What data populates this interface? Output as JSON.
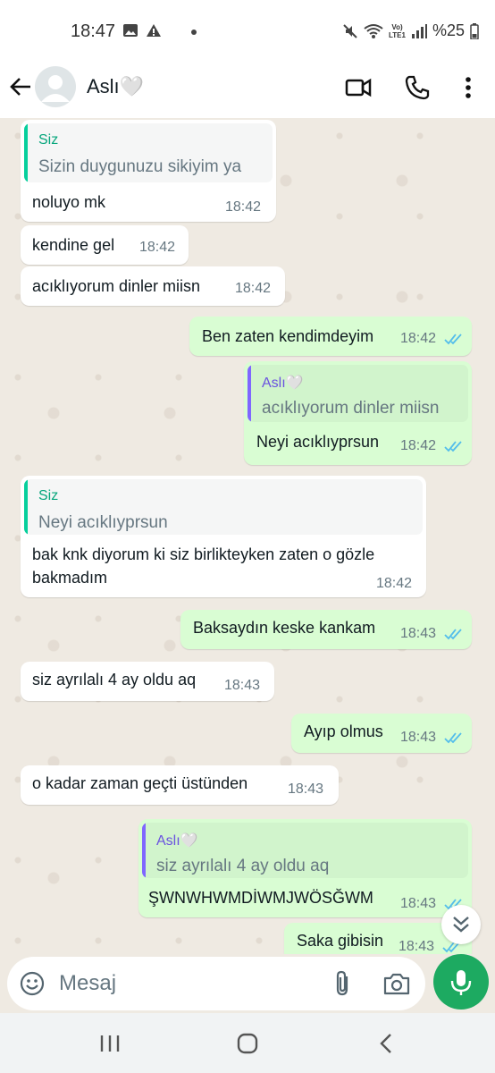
{
  "status_bar": {
    "time": "18:47",
    "battery": "%25",
    "network": "VoLTE1"
  },
  "header": {
    "contact_name": "Aslı🤍"
  },
  "messages": [
    {
      "quote_name": "Siz",
      "quote_text": "Sizin duygunuzu sikiyim ya",
      "text": "noluyo mk",
      "time": "18:42"
    },
    {
      "text": "kendine gel",
      "time": "18:42"
    },
    {
      "text": "acıklıyorum dinler miisn",
      "time": "18:42"
    },
    {
      "text": "Ben zaten kendimdeyim",
      "time": "18:42"
    },
    {
      "quote_name": "Aslı🤍",
      "quote_text": "acıklıyorum dinler miisn",
      "text": "Neyi acıklıyprsun",
      "time": "18:42"
    },
    {
      "quote_name": "Siz",
      "quote_text": "Neyi acıklıyprsun",
      "line1": "bak knk diyorum ki siz birlikteyken zaten o gözle",
      "line2": "bakmadım",
      "time": "18:42"
    },
    {
      "text": "Baksaydın keske kankam",
      "time": "18:43"
    },
    {
      "text": "siz ayrılalı 4 ay oldu aq",
      "time": "18:43"
    },
    {
      "text": "Ayıp olmus",
      "time": "18:43"
    },
    {
      "text": "o kadar zaman geçti üstünden",
      "time": "18:43"
    },
    {
      "quote_name": "Aslı🤍",
      "quote_text": "siz ayrılalı 4 ay oldu aq",
      "text": "ŞWNWHWMDİWMJWÖSĞWM",
      "time": "18:43"
    },
    {
      "text": "Saka gibisin",
      "time": "18:43"
    }
  ],
  "input": {
    "placeholder": "Mesaj"
  },
  "icons": {
    "back": "back-arrow-icon",
    "video": "video-call-icon",
    "phone": "phone-icon",
    "menu": "more-vert-icon",
    "emoji": "emoji-icon",
    "attach": "attach-icon",
    "camera": "camera-icon",
    "mic": "mic-icon",
    "scroll": "double-chevron-down-icon"
  },
  "colors": {
    "outgoing": "#d9fdd3",
    "incoming": "#ffffff",
    "accent": "#1daa61",
    "read_ticks": "#53bdeb",
    "quote_self": "#06cf9c",
    "quote_other": "#7f66ff"
  }
}
